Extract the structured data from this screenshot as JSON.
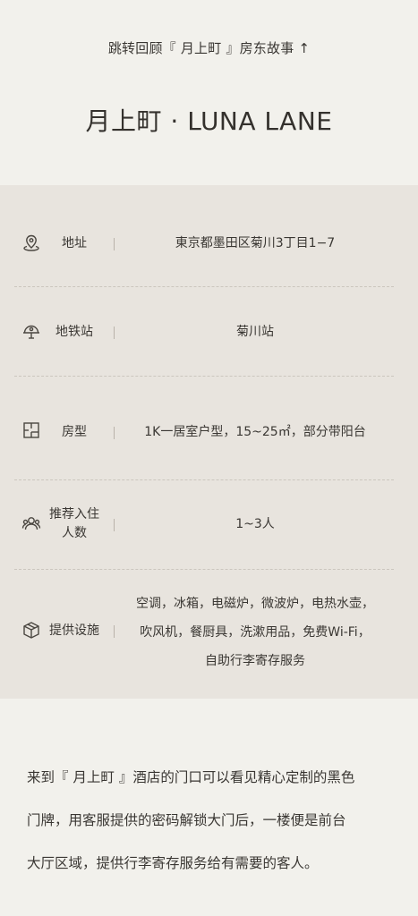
{
  "header": {
    "back_link": "跳转回顾『 月上町 』房东故事 ↑",
    "title": "月上町 · LUNA LANE"
  },
  "info": {
    "address": {
      "icon": "location-pin-icon",
      "label": "地址",
      "value": "東京都墨田区菊川3丁目1−7"
    },
    "subway": {
      "icon": "subway-station-icon",
      "label": "地铁站",
      "value": "菊川站"
    },
    "room_type": {
      "icon": "floor-plan-icon",
      "label": "房型",
      "value": "1K一居室户型，15~25㎡，部分带阳台"
    },
    "occupancy": {
      "icon": "people-icon",
      "label_line1": "推荐入住",
      "label_line2": "人数",
      "value": "1~3人"
    },
    "facilities": {
      "icon": "amenities-box-icon",
      "label": "提供设施",
      "value_line1": "空调，冰箱，电磁炉，微波炉，电热水壶，",
      "value_line2": "吹风机，餐厨具，洗漱用品，免费Wi-Fi，",
      "value_line3": "自助行李寄存服务"
    }
  },
  "description": {
    "line1": "来到『 月上町 』酒店的门口可以看见精心定制的黑色",
    "line2": "门牌，用客服提供的密码解锁大门后，一楼便是前台",
    "line3": "大厅区域，提供行李寄存服务给有需要的客人。"
  }
}
